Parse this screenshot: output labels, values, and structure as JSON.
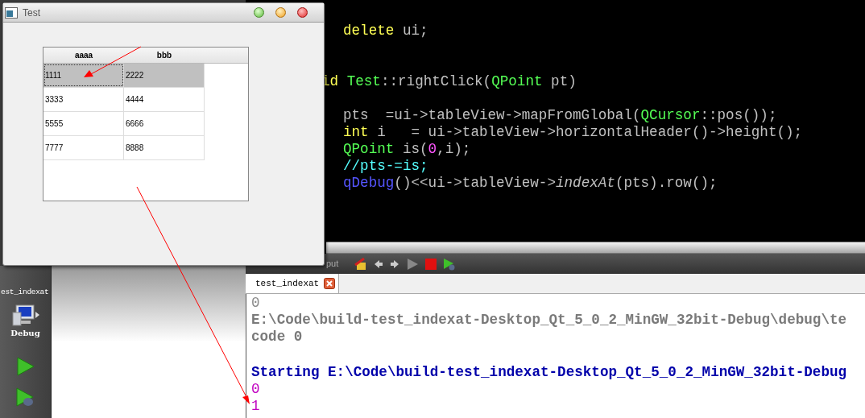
{
  "test_window": {
    "title": "Test",
    "table": {
      "columns": [
        "aaaa",
        "bbb"
      ],
      "rows": [
        {
          "cells": [
            "1111",
            "2222"
          ],
          "selected": true
        },
        {
          "cells": [
            "3333",
            "4444"
          ],
          "selected": false
        },
        {
          "cells": [
            "5555",
            "6666"
          ],
          "selected": false
        },
        {
          "cells": [
            "7777",
            "8888"
          ],
          "selected": false
        }
      ]
    }
  },
  "editor": {
    "lines": [
      {
        "kind": "code",
        "indent": true,
        "segments": [
          {
            "text": "delete",
            "kind": "keyword"
          },
          {
            "text": " ui;",
            "kind": "plain"
          }
        ]
      },
      {
        "kind": "blank"
      },
      {
        "kind": "blank"
      },
      {
        "kind": "code",
        "indent": false,
        "segments": [
          {
            "text": "id ",
            "kind": "keyword"
          },
          {
            "text": "Test",
            "kind": "type"
          },
          {
            "text": "::rightClick(",
            "kind": "plain"
          },
          {
            "text": "QPoint",
            "kind": "type"
          },
          {
            "text": " pt)",
            "kind": "plain"
          }
        ]
      },
      {
        "kind": "blank"
      },
      {
        "kind": "code",
        "indent": true,
        "segments": [
          {
            "text": "pts  =ui->tableView->mapFromGlobal(",
            "kind": "plain"
          },
          {
            "text": "QCursor",
            "kind": "type"
          },
          {
            "text": "::pos());",
            "kind": "plain"
          }
        ]
      },
      {
        "kind": "code",
        "indent": true,
        "segments": [
          {
            "text": "int",
            "kind": "keyword"
          },
          {
            "text": " i   = ui->tableView->horizontalHeader()->height();",
            "kind": "plain"
          }
        ]
      },
      {
        "kind": "code",
        "indent": true,
        "segments": [
          {
            "text": "QPoint",
            "kind": "type"
          },
          {
            "text": " is(",
            "kind": "plain"
          },
          {
            "text": "0",
            "kind": "number"
          },
          {
            "text": ",i);",
            "kind": "plain"
          }
        ]
      },
      {
        "kind": "code",
        "indent": true,
        "segments": [
          {
            "text": "//pts-=is;",
            "kind": "comment"
          }
        ]
      },
      {
        "kind": "code",
        "indent": true,
        "segments": [
          {
            "text": "qDebug",
            "kind": "function"
          },
          {
            "text": "()<<ui->tableView->",
            "kind": "plain"
          },
          {
            "text": "indexAt",
            "kind": "italic"
          },
          {
            "text": "(pts).row();",
            "kind": "plain"
          }
        ]
      }
    ]
  },
  "sidebar": {
    "project": "est_indexat",
    "build_config": "Debug"
  },
  "output_toolbar": {
    "label": "put"
  },
  "output": {
    "tabs": [
      {
        "label": "test_indexat",
        "selected": true
      }
    ],
    "lines": [
      {
        "kind": "plain",
        "text": "0"
      },
      {
        "kind": "system",
        "text": "E:\\Code\\build-test_indexat-Desktop_Qt_5_0_2_MinGW_32bit-Debug\\debug\\te"
      },
      {
        "kind": "system",
        "text": "code 0"
      },
      {
        "kind": "blank"
      },
      {
        "kind": "start",
        "text": "Starting E:\\Code\\build-test_indexat-Desktop_Qt_5_0_2_MinGW_32bit-Debug"
      },
      {
        "kind": "debug",
        "text": "0"
      },
      {
        "kind": "debug",
        "text": "1"
      }
    ]
  }
}
